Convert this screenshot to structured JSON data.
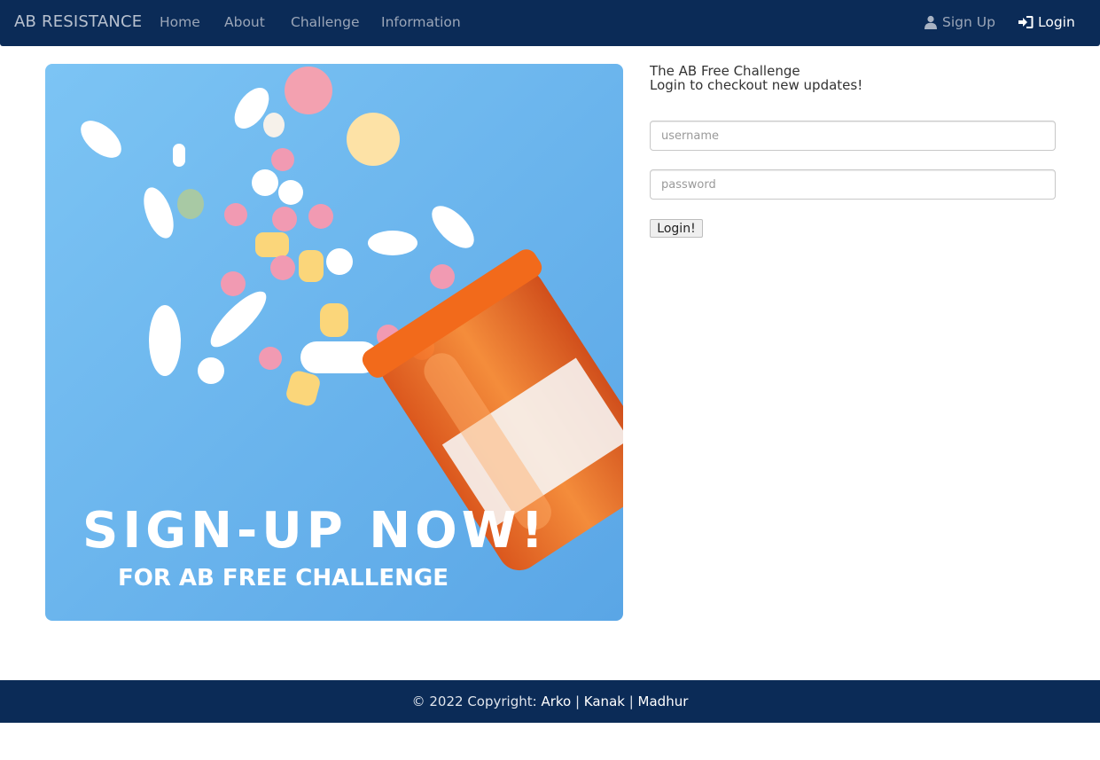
{
  "navbar": {
    "brand": "AB RESISTANCE",
    "links": [
      "Home",
      "About",
      "Challenge",
      "Information"
    ],
    "signup_label": "Sign Up",
    "login_label": "Login",
    "signup_icon": "user-icon",
    "login_icon": "sign-in-icon"
  },
  "hero": {
    "headline": "SIGN-UP NOW!",
    "subline": "FOR AB FREE CHALLENGE"
  },
  "intro": {
    "title": "The AB Free Challenge",
    "subtitle": "Login to checkout new updates!"
  },
  "form": {
    "username_placeholder": "username",
    "password_placeholder": "password",
    "submit_label": "Login!"
  },
  "footer": {
    "prefix": "© 2022 Copyright: ",
    "authors": [
      "Arko",
      "Kanak",
      "Madhur"
    ],
    "separator": " | "
  },
  "colors": {
    "navbar_bg": "#0b2b57",
    "hero_sky": "#6ab7ef"
  }
}
